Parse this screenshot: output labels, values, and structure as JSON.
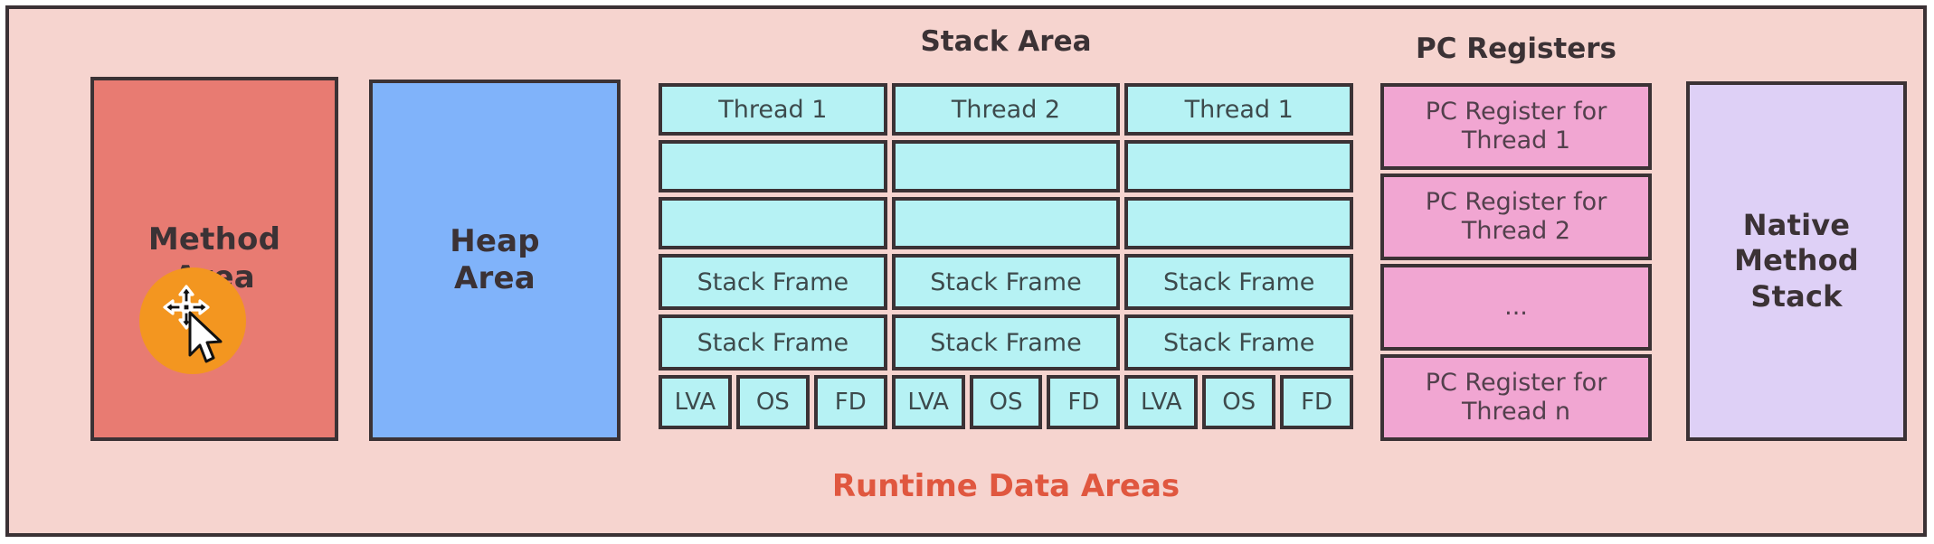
{
  "diagram": {
    "caption": "Runtime Data Areas",
    "caption_color": "#e0573f",
    "background_color": "#f6d4cf",
    "border_color": "#3b3235"
  },
  "method_area": {
    "label": "Method\nArea",
    "label_line1": "Method",
    "label_line2": "Area",
    "color": "#e87b72"
  },
  "heap_area": {
    "label_line1": "Heap",
    "label_line2": "Area",
    "color": "#80b3fa"
  },
  "cursor": {
    "highlight_color": "#f39620",
    "move_cursor_icon": "move-cursor-icon",
    "pointer_icon": "arrow-pointer-icon"
  },
  "stack_area": {
    "title": "Stack Area",
    "cell_color": "#b6f2f4",
    "columns": [
      {
        "header": "Thread 1",
        "blanks": [
          "",
          ""
        ],
        "frames": [
          "Stack Frame",
          "Stack Frame"
        ],
        "parts": [
          "LVA",
          "OS",
          "FD"
        ]
      },
      {
        "header": "Thread 2",
        "blanks": [
          "",
          ""
        ],
        "frames": [
          "Stack Frame",
          "Stack Frame"
        ],
        "parts": [
          "LVA",
          "OS",
          "FD"
        ]
      },
      {
        "header": "Thread 1",
        "blanks": [
          "",
          ""
        ],
        "frames": [
          "Stack Frame",
          "Stack Frame"
        ],
        "parts": [
          "LVA",
          "OS",
          "FD"
        ]
      }
    ]
  },
  "pc_registers": {
    "title": "PC Registers",
    "cell_color": "#f1a6d2",
    "rows": [
      "PC Register for Thread 1",
      "PC Register for Thread 2",
      "...",
      "PC Register for Thread n"
    ]
  },
  "native_method_stack": {
    "label_line1": "Native",
    "label_line2": "Method",
    "label_line3": "Stack",
    "color": "#ded0f6"
  }
}
